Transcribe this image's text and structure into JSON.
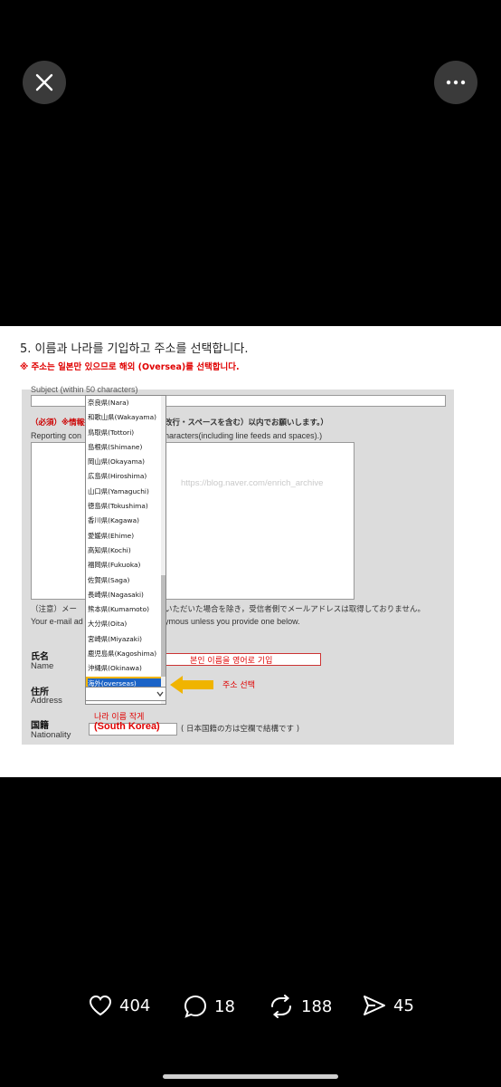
{
  "viewer": {
    "close_icon": "close-icon",
    "more_icon": "more-horizontal-icon"
  },
  "image": {
    "step_title": "5. 이름과 나라를 기입하고 주소를 선택합니다.",
    "note": "※ 주소는 일본만 있으므로 해외 (Oversea)를 선택합니다.",
    "form": {
      "subject_label": "Subject (within 50 characters)",
      "required_line": "（必須）※情報提供",
      "required_line2": "改行・スペースを含む）以内でお願いします。）",
      "reporting_left": "Reporting con",
      "reporting_right": "haracters(including line feeds and spaces).)",
      "watermark": "https://blog.naver.com/enrich_archive",
      "notice_left": "（注意）メー",
      "notice_right": "いただいた場合を除き，受信者側でメールアドレスは取得しておりません。",
      "email_left": "Your e-mail ad",
      "email_right": "ymous unless you provide one below.",
      "name_jp": "氏名",
      "name_en": "Name",
      "name_annotation": "본인 이름을 영어로 기입",
      "address_jp": "住所",
      "address_en": "Address",
      "address_annotation": "주소 선택",
      "nationality_jp": "国籍",
      "nationality_en": "Nationality",
      "nationality_annotation": "나라 이름 작게",
      "nationality_value": "(South Korea)",
      "nationality_hint": "( 日本国籍の方は空欄で結構です )"
    },
    "dropdown_options": [
      "奈良県(Nara)",
      "和歌山県(Wakayama)",
      "鳥取県(Tottori)",
      "島根県(Shimane)",
      "岡山県(Okayama)",
      "広島県(Hiroshima)",
      "山口県(Yamaguchi)",
      "徳島県(Tokushima)",
      "香川県(Kagawa)",
      "愛媛県(Ehime)",
      "高知県(Kochi)",
      "福岡県(Fukuoka)",
      "佐賀県(Saga)",
      "長崎県(Nagasaki)",
      "熊本県(Kumamoto)",
      "大分県(Oita)",
      "宮崎県(Miyazaki)",
      "鹿児島県(Kagoshima)",
      "沖縄県(Okinawa)",
      "海外(overseas)"
    ],
    "selected_option": "海外(overseas)"
  },
  "actions": {
    "likes": "404",
    "replies": "18",
    "reposts": "188",
    "shares": "45"
  },
  "colors": {
    "background": "#000000",
    "annotation_red": "#e00000",
    "selection_blue": "#1a63c7",
    "arrow_yellow": "#f0b400"
  }
}
